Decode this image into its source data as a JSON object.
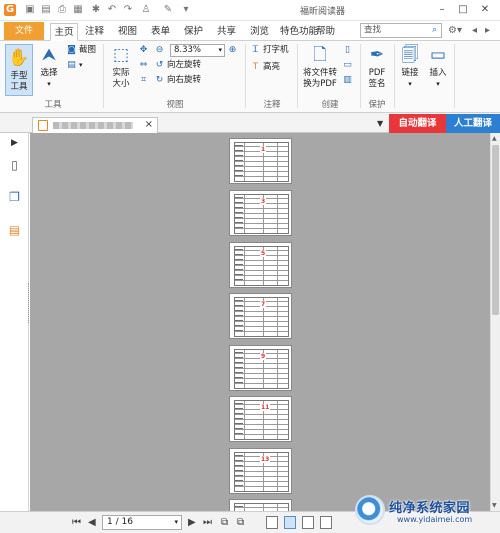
{
  "window": {
    "title": "福昕阅读器",
    "controls": {
      "minimize": "–",
      "maximize": "□",
      "close": "✕"
    }
  },
  "menu": {
    "file": "文件",
    "tabs": [
      "主页",
      "注释",
      "视图",
      "表单",
      "保护",
      "共享",
      "浏览",
      "特色功能",
      "帮助"
    ],
    "active_tab": "主页",
    "search_placeholder": "查找"
  },
  "ribbon": {
    "tools_group": {
      "label": "工具",
      "hand_tool": "手型\n工具",
      "select": "选择",
      "snapshot": "截图"
    },
    "view_group": {
      "label": "视图",
      "actual_size": "实际\n大小",
      "zoom_value": "8.33%",
      "rotate_left": "向左旋转",
      "rotate_right": "向右旋转"
    },
    "annotation_group": {
      "label": "注释",
      "typewriter": "打字机",
      "highlight": "高亮"
    },
    "create_group": {
      "label": "创建",
      "convert_pdf": "将文件转\n换为PDF"
    },
    "protect_group": {
      "label": "保护",
      "pdf_sign": "PDF\n签名"
    },
    "links_group": {
      "link": "链接",
      "insert": "插入"
    }
  },
  "document_tabs": {
    "auto_translate": "自动翻译",
    "manual_translate": "人工翻译",
    "close": "×"
  },
  "pages": {
    "visible_page_numbers": [
      "1",
      "3",
      "5",
      "7",
      "9",
      "11",
      "13"
    ]
  },
  "status": {
    "page_indicator": "1 / 16"
  },
  "watermark": {
    "title": "纯净系统家园",
    "url": "www.yidaimei.com"
  }
}
